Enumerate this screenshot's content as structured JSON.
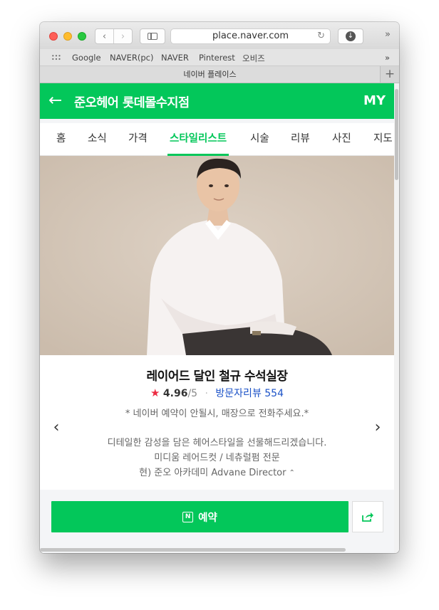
{
  "browser": {
    "url": "place.naver.com",
    "bookmarks": [
      "Google",
      "NAVER(pc)",
      "NAVER",
      "Pinterest",
      "오비즈"
    ],
    "tab_title": "네이버 플레이스",
    "more_glyph": "»",
    "new_tab_glyph": "+"
  },
  "header": {
    "back_glyph": "←",
    "title": "준오헤어 롯데몰수지점",
    "my_label": "MY",
    "brand_color": "#03c75a"
  },
  "tabs": [
    {
      "label": "홈",
      "active": false
    },
    {
      "label": "소식",
      "active": false
    },
    {
      "label": "가격",
      "active": false
    },
    {
      "label": "스타일리스트",
      "active": true
    },
    {
      "label": "시술",
      "active": false
    },
    {
      "label": "리뷰",
      "active": false
    },
    {
      "label": "사진",
      "active": false
    },
    {
      "label": "지도",
      "active": false
    }
  ],
  "stylist": {
    "name": "레이어드 달인 철규 수석실장",
    "star_glyph": "★",
    "rating": "4.96",
    "rating_max": "/5",
    "review_label": "방문자리뷰 554",
    "notice": "* 네이버 예약이 안될시, 매장으로 전화주세요.*",
    "description": [
      "디테일한 감성을 담은 헤어스타일을 선물해드리겠습니다.",
      "미디움 레어드컷 / 네츄럴펌 전문",
      "현) 준오 아카데미 Advane Director"
    ]
  },
  "carousel": {
    "prev_glyph": "‹",
    "next_glyph": "›"
  },
  "actions": {
    "reserve_label": "예약",
    "calendar_letter": "N"
  }
}
